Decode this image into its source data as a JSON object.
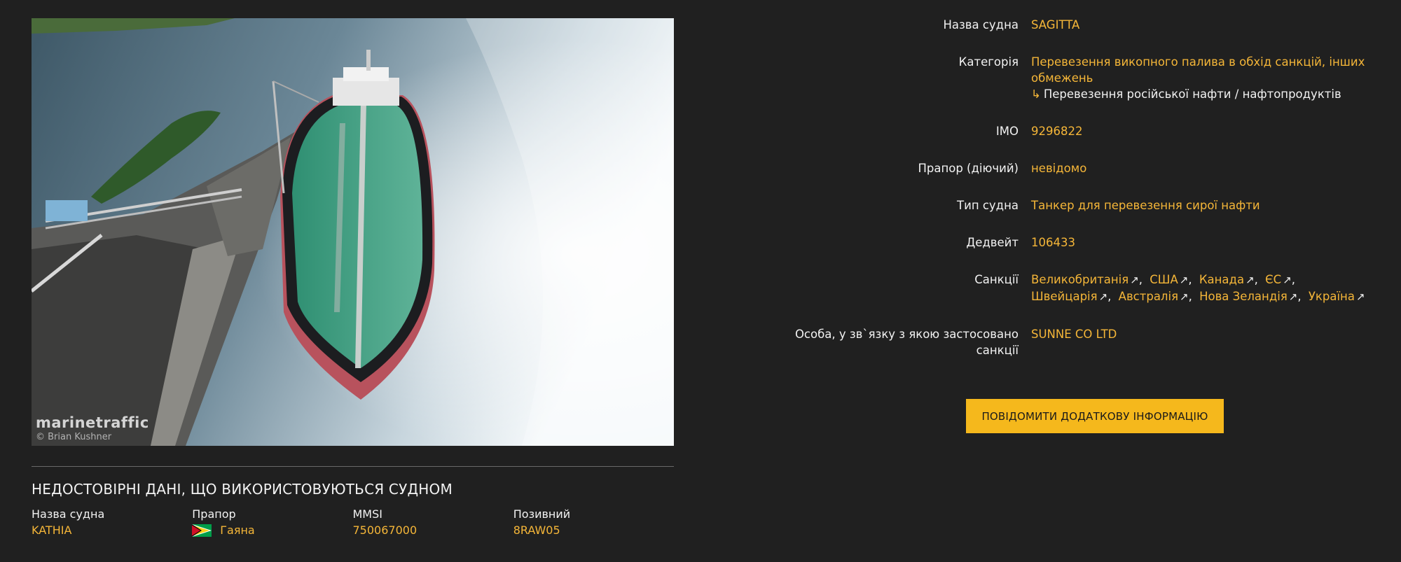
{
  "photo": {
    "watermark_brand": "marinetraffic",
    "watermark_credit": "© Brian Kushner"
  },
  "unreliable": {
    "title": "НЕДОСТОВІРНІ ДАНІ, ЩО ВИКОРИСТОВУЮТЬСЯ СУДНОМ",
    "columns": [
      {
        "label": "Назва судна",
        "value": "KATHIA"
      },
      {
        "label": "Прапор",
        "value": "Гаяна",
        "flag_icon": "guyana-flag-icon"
      },
      {
        "label": "MMSI",
        "value": "750067000"
      },
      {
        "label": "Позивний",
        "value": "8RAW05"
      }
    ]
  },
  "details": {
    "vessel_name": {
      "label": "Назва судна",
      "value": "SAGITTA"
    },
    "category": {
      "label": "Категорія",
      "value": "Перевезення викопного палива в обхід санкцій, інших обмежень",
      "sub_arrow": "↳",
      "sub_value": "Перевезення російської нафти / нафтопродуктів"
    },
    "imo": {
      "label": "IMO",
      "value": "9296822"
    },
    "flag": {
      "label": "Прапор (діючий)",
      "value": "невідомо"
    },
    "vessel_type": {
      "label": "Тип судна",
      "value": "Танкер для перевезення сирої нафти"
    },
    "deadweight": {
      "label": "Дедвейт",
      "value": "106433"
    },
    "sanctions": {
      "label": "Санкції",
      "items": [
        "Великобританія",
        "США",
        "Канада",
        "ЄС",
        "Швейцарія",
        "Австралія",
        "Нова Зеландія",
        "Україна"
      ],
      "ext_icon": "↗"
    },
    "sanctioned_person": {
      "label": "Особа, у зв`язку з якою застосовано санкції",
      "value": "SUNNE CO LTD"
    }
  },
  "report_button": {
    "label": "ПОВІДОМИТИ ДОДАТКОВУ ІНФОРМАЦІЮ"
  },
  "colors": {
    "background": "#202020",
    "accent": "#f5b638",
    "button": "#f5b81c",
    "text": "#f2f2f2"
  }
}
